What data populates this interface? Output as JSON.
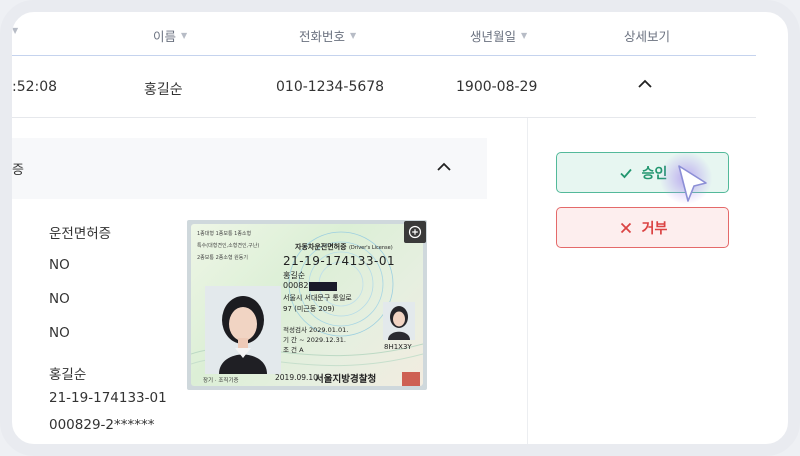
{
  "table": {
    "headers": {
      "name": "이름",
      "phone": "전화번호",
      "birth": "생년월일",
      "detail": "상세보기"
    },
    "row": {
      "time": ":52:08",
      "name": "홍길순",
      "phone": "010-1234-5678",
      "birth": "1900-08-29"
    }
  },
  "detail": {
    "section_title": "증",
    "fields": {
      "license_label": "운전면허증",
      "value1": "NO",
      "value2": "NO",
      "value3": "NO",
      "holder_name": "홍길순",
      "license_number": "21-19-174133-01",
      "resident_number": "000829-2******"
    }
  },
  "license_card": {
    "header_small_1": "1종대형 1종보통 1종소형",
    "header_small_2": "특수(대형견인,소형견인,구난)",
    "header_small_3": "2종보통 2종소형 원동기",
    "title": "자동차운전면허증",
    "title_en": "(Driver's License)",
    "number": "21-19-174133-01",
    "name": "홍길순",
    "resident_prefix": "000829-2",
    "address_1": "서울시 서대문구 통일로",
    "address_2": "97 (미근동 209)",
    "renewal_label": "적성검사",
    "renewal_date": "2029.01.01.",
    "period_label": "기    간",
    "period_value": "~ 2029.12.31.",
    "condition_label": "조    건",
    "condition_value": "A",
    "serial": "8H1X3Y",
    "donor": "장기 · 조직기증",
    "issue_date": "2019.09.10.",
    "issuer": "서울지방경찰청"
  },
  "actions": {
    "approve_label": "승인",
    "reject_label": "거부"
  },
  "colors": {
    "approve_border": "#53b99a",
    "approve_text": "#22966f",
    "reject_border": "#e46a6a",
    "reject_text": "#db4343",
    "header_divider": "#c5d3ee"
  }
}
